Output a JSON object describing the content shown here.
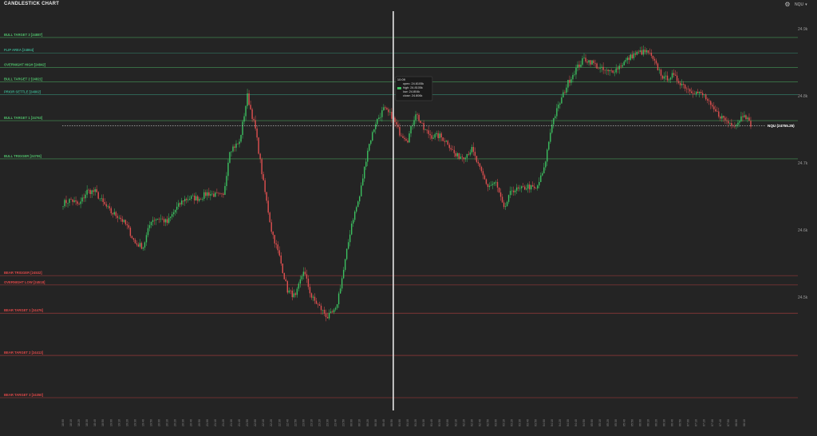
{
  "header": {
    "title": "CANDLESTICK CHART",
    "settings_icon": "gear-icon",
    "symbol": "NQU",
    "symbol_dropdown_icon": "chevron-down-icon"
  },
  "chart_data": {
    "type": "candlestick",
    "title": "CANDLESTICK CHART",
    "y_range": [
      24380,
      24900
    ],
    "y_ticks": [
      {
        "value": 24500,
        "label": "24.5k"
      },
      {
        "value": 24600,
        "label": "24.6k"
      },
      {
        "value": 24700,
        "label": "24.7k"
      },
      {
        "value": 24800,
        "label": "24.8k"
      },
      {
        "value": 24900,
        "label": "24.9k"
      }
    ],
    "levels": [
      {
        "label": "BULL TARGET 3 [24887]",
        "value": 24887,
        "color": "#4fbf6a"
      },
      {
        "label": "FLIP AREA [24864]",
        "value": 24864,
        "color": "#3aa88a"
      },
      {
        "label": "OVERNIGHT HIGH [24842]",
        "value": 24842,
        "color": "#4fbf6a"
      },
      {
        "label": "BULL TARGET 2 [24821]",
        "value": 24821,
        "color": "#4fbf6a"
      },
      {
        "label": "PRIOR SETTLE [24802]",
        "value": 24802,
        "color": "#3aa88a"
      },
      {
        "label": "BULL TARGET 1 [24763]",
        "value": 24763,
        "color": "#4fbf6a"
      },
      {
        "label": "BULL TRIGGER [24706]",
        "value": 24706,
        "color": "#4fbf6a"
      },
      {
        "label": "BEAR TRIGGER [24532]",
        "value": 24532,
        "color": "#e04848"
      },
      {
        "label": "OVERNIGHT LOW [24518]",
        "value": 24518,
        "color": "#e04848"
      },
      {
        "label": "BEAR TARGET 1 [24476]",
        "value": 24476,
        "color": "#e04848"
      },
      {
        "label": "BEAR TARGET 2 [24413]",
        "value": 24413,
        "color": "#e04848"
      },
      {
        "label": "BEAR TARGET 3 [24350]",
        "value": 24350,
        "color": "#e04848"
      }
    ],
    "last_price": {
      "label": "NQU (24755.25)",
      "value": 24755.25
    },
    "crosshair": {
      "index": 205
    },
    "tooltip": {
      "time": "10:09",
      "open": "open: 24.8105k",
      "high": "high: 24.8105k",
      "low": "low: 24.804k",
      "close": "close: 24.806k"
    },
    "colors": {
      "up": "#3cc060",
      "down": "#e05050",
      "background": "#242424",
      "grid": "#3a3a3a"
    },
    "grid": false,
    "anchors": [
      [
        0,
        24640
      ],
      [
        5,
        24645
      ],
      [
        10,
        24637
      ],
      [
        15,
        24658
      ],
      [
        20,
        24657
      ],
      [
        25,
        24640
      ],
      [
        30,
        24626
      ],
      [
        35,
        24620
      ],
      [
        40,
        24605
      ],
      [
        45,
        24580
      ],
      [
        50,
        24575
      ],
      [
        55,
        24615
      ],
      [
        60,
        24618
      ],
      [
        65,
        24611
      ],
      [
        70,
        24630
      ],
      [
        75,
        24645
      ],
      [
        80,
        24648
      ],
      [
        85,
        24647
      ],
      [
        90,
        24655
      ],
      [
        95,
        24652
      ],
      [
        100,
        24650
      ],
      [
        104,
        24720
      ],
      [
        110,
        24730
      ],
      [
        115,
        24800
      ],
      [
        120,
        24750
      ],
      [
        125,
        24670
      ],
      [
        130,
        24600
      ],
      [
        135,
        24560
      ],
      [
        140,
        24510
      ],
      [
        145,
        24500
      ],
      [
        150,
        24540
      ],
      [
        155,
        24500
      ],
      [
        160,
        24485
      ],
      [
        165,
        24470
      ],
      [
        170,
        24480
      ],
      [
        175,
        24540
      ],
      [
        180,
        24610
      ],
      [
        185,
        24650
      ],
      [
        190,
        24720
      ],
      [
        195,
        24760
      ],
      [
        200,
        24780
      ],
      [
        205,
        24770
      ],
      [
        210,
        24745
      ],
      [
        215,
        24735
      ],
      [
        220,
        24775
      ],
      [
        225,
        24750
      ],
      [
        230,
        24740
      ],
      [
        235,
        24740
      ],
      [
        240,
        24730
      ],
      [
        245,
        24710
      ],
      [
        250,
        24710
      ],
      [
        255,
        24720
      ],
      [
        260,
        24690
      ],
      [
        265,
        24665
      ],
      [
        270,
        24670
      ],
      [
        275,
        24630
      ],
      [
        280,
        24660
      ],
      [
        285,
        24660
      ],
      [
        290,
        24665
      ],
      [
        295,
        24660
      ],
      [
        300,
        24690
      ],
      [
        305,
        24760
      ],
      [
        310,
        24790
      ],
      [
        315,
        24820
      ],
      [
        320,
        24840
      ],
      [
        325,
        24855
      ],
      [
        330,
        24850
      ],
      [
        335,
        24840
      ],
      [
        340,
        24835
      ],
      [
        345,
        24840
      ],
      [
        350,
        24850
      ],
      [
        355,
        24860
      ],
      [
        360,
        24865
      ],
      [
        365,
        24865
      ],
      [
        370,
        24845
      ],
      [
        375,
        24825
      ],
      [
        380,
        24830
      ],
      [
        385,
        24820
      ],
      [
        390,
        24810
      ],
      [
        395,
        24805
      ],
      [
        400,
        24800
      ],
      [
        405,
        24780
      ],
      [
        410,
        24770
      ],
      [
        415,
        24760
      ],
      [
        420,
        24758
      ],
      [
        425,
        24775
      ],
      [
        429,
        24754
      ]
    ]
  }
}
